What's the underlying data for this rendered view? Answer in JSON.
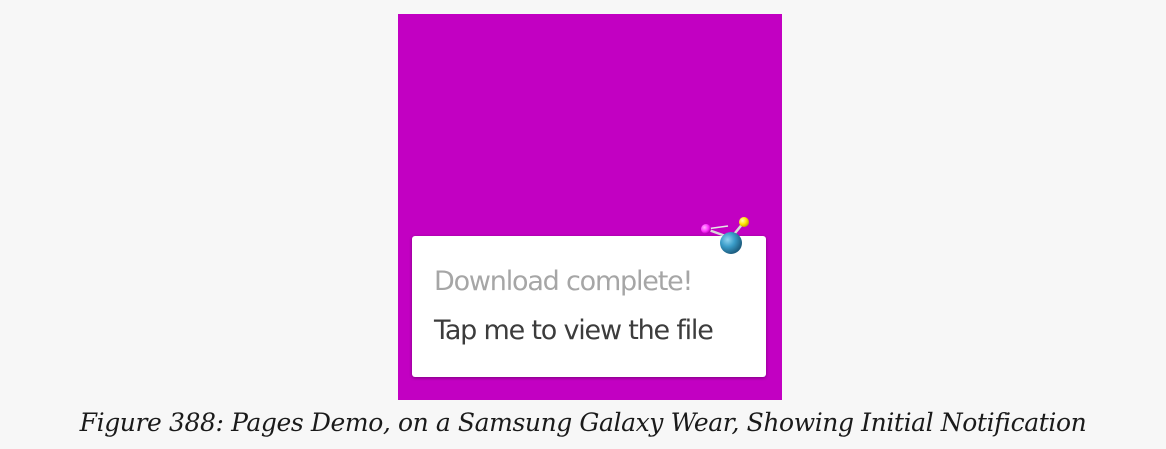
{
  "screen": {
    "background_color": "#c200c2"
  },
  "notification": {
    "title": "Download complete!",
    "text": "Tap me to view the file",
    "icon": "molecule-icon"
  },
  "caption": "Figure 388: Pages Demo, on a Samsung Galaxy Wear, Showing Initial Notification"
}
